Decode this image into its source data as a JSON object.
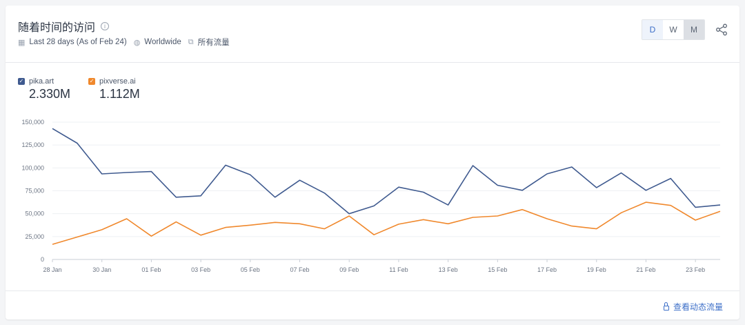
{
  "header": {
    "title": "随着时间的访问",
    "info_icon": "info-icon",
    "date_range": "Last 28 days (As of Feb 24)",
    "region": "Worldwide",
    "traffic": "所有流量"
  },
  "toggle": {
    "d": "D",
    "w": "W",
    "m": "M",
    "selected": "M"
  },
  "legend": [
    {
      "name": "pika.art",
      "value": "2.330M",
      "color": "#3f5a8f"
    },
    {
      "name": "pixverse.ai",
      "value": "1.112M",
      "color": "#f0882c"
    }
  ],
  "footer": {
    "link": "查看动态流量"
  },
  "chart_data": {
    "type": "line",
    "ylim": [
      0,
      150000
    ],
    "yticks": [
      "0",
      "25,000",
      "50,000",
      "75,000",
      "100,000",
      "125,000",
      "150,000"
    ],
    "x": [
      "28 Jan",
      "29 Jan",
      "30 Jan",
      "31 Jan",
      "01 Feb",
      "02 Feb",
      "03 Feb",
      "04 Feb",
      "05 Feb",
      "06 Feb",
      "07 Feb",
      "08 Feb",
      "09 Feb",
      "10 Feb",
      "11 Feb",
      "12 Feb",
      "13 Feb",
      "14 Feb",
      "15 Feb",
      "16 Feb",
      "17 Feb",
      "18 Feb",
      "19 Feb",
      "20 Feb",
      "21 Feb",
      "22 Feb",
      "23 Feb",
      "24 Feb"
    ],
    "xticks": [
      "28 Jan",
      "30 Jan",
      "01 Feb",
      "03 Feb",
      "05 Feb",
      "07 Feb",
      "09 Feb",
      "11 Feb",
      "13 Feb",
      "15 Feb",
      "17 Feb",
      "19 Feb",
      "21 Feb",
      "23 Feb"
    ],
    "series": [
      {
        "name": "pika.art",
        "color": "#3f5a8f",
        "values": [
          143000,
          127000,
          93500,
          95000,
          96000,
          68000,
          69500,
          103000,
          92500,
          68000,
          86500,
          72500,
          50000,
          58500,
          79000,
          73500,
          59500,
          102500,
          81000,
          75500,
          93500,
          101000,
          78500,
          94500,
          75500,
          88500,
          57000,
          59500
        ]
      },
      {
        "name": "pixverse.ai",
        "color": "#f0882c",
        "values": [
          16500,
          24500,
          32500,
          44500,
          25500,
          41000,
          26500,
          35000,
          37500,
          40500,
          39000,
          33500,
          47500,
          27000,
          38500,
          43500,
          39000,
          46000,
          47500,
          54500,
          44500,
          36500,
          33500,
          51000,
          62500,
          59000,
          43000,
          52500
        ]
      }
    ],
    "grid": true,
    "legend": "top-left"
  }
}
